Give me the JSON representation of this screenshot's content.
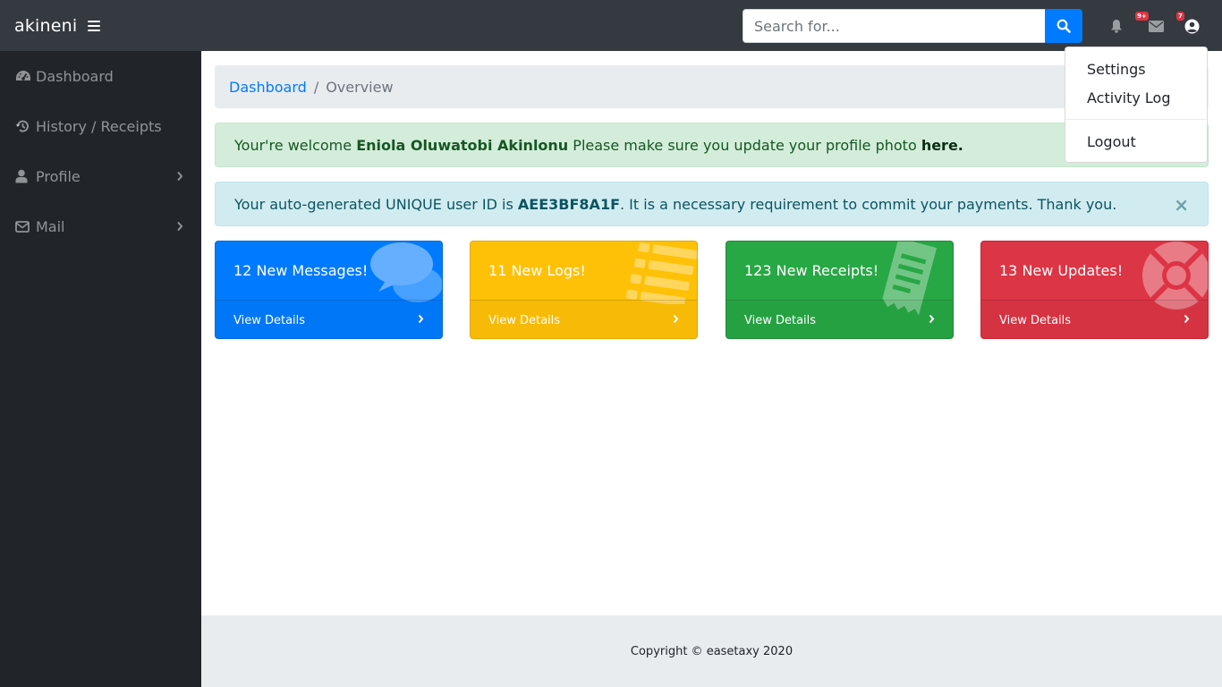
{
  "navbar": {
    "brand": "akineni",
    "search_placeholder": "Search for...",
    "messages_badge": "9+",
    "user_badge": "7"
  },
  "sidebar": {
    "items": [
      {
        "label": "Dashboard",
        "icon": "tachometer-icon"
      },
      {
        "label": "History / Receipts",
        "icon": "history-icon"
      },
      {
        "label": "Profile",
        "icon": "user-icon"
      },
      {
        "label": "Mail",
        "icon": "envelope-icon"
      }
    ]
  },
  "breadcrumb": {
    "link": "Dashboard",
    "separator": "/",
    "current": "Overview"
  },
  "alerts": {
    "welcome": {
      "prefix": "Your're welcome ",
      "name": "Eniola Oluwatobi Akinlonu",
      "middle": " Please make sure you update your profile photo ",
      "link": "here."
    },
    "userid": {
      "prefix": "Your auto-generated UNIQUE user ID is ",
      "id": "AEE3BF8A1F",
      "suffix": ". It is a necessary requirement to commit your payments. Thank you.",
      "close": "×"
    }
  },
  "cards": [
    {
      "title": "12 New Messages!",
      "link": "View Details",
      "color": "#007bff",
      "icon": "comments-icon"
    },
    {
      "title": "11 New Logs!",
      "link": "View Details",
      "color": "#ffc107",
      "icon": "list-icon"
    },
    {
      "title": "123 New Receipts!",
      "link": "View Details",
      "color": "#28a745",
      "icon": "receipt-icon"
    },
    {
      "title": "13 New Updates!",
      "link": "View Details",
      "color": "#dc3545",
      "icon": "life-ring-icon"
    }
  ],
  "dropdown": {
    "settings": "Settings",
    "activity_log": "Activity Log",
    "logout": "Logout"
  },
  "footer": {
    "copyright": "Copyright © easetaxy 2020"
  }
}
